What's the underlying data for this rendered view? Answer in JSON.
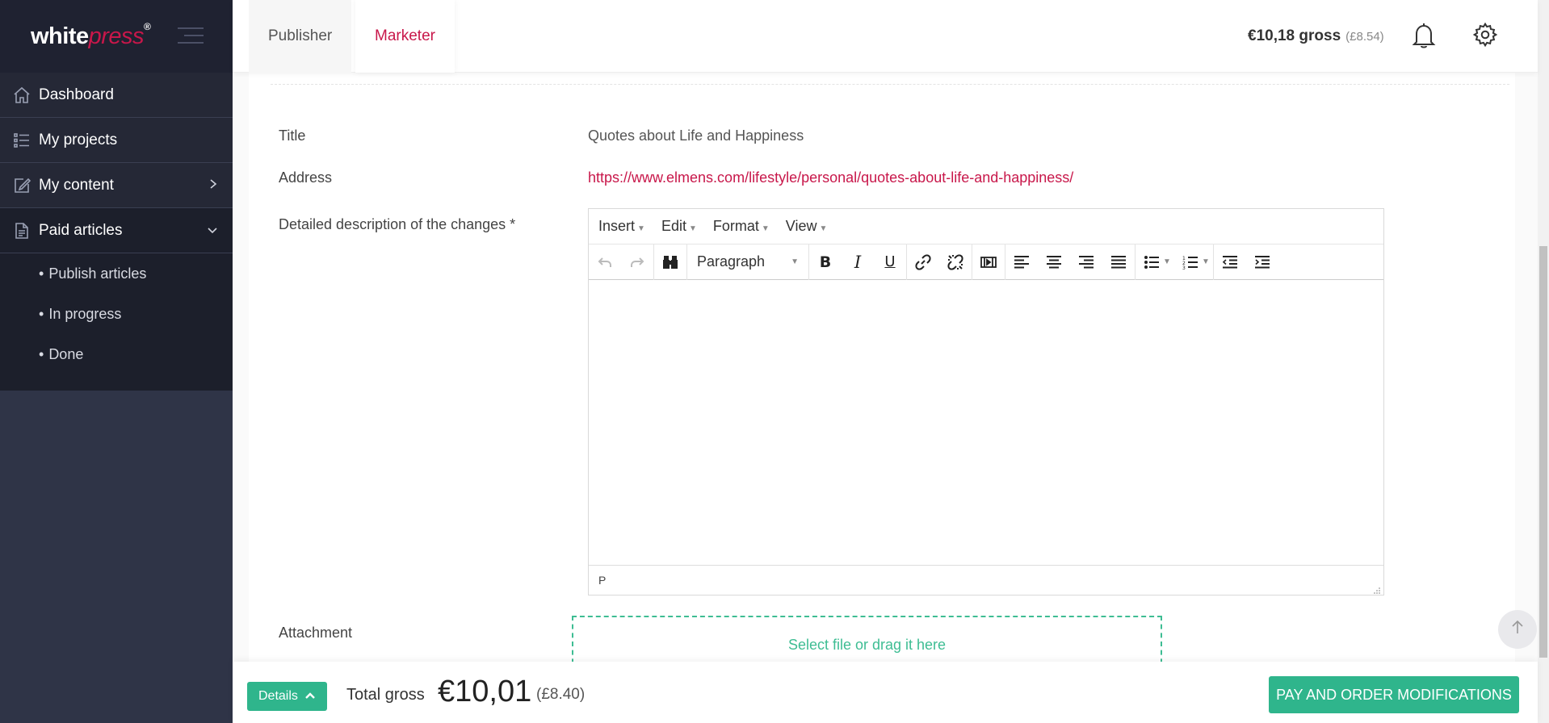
{
  "app": {
    "logo_main": "white",
    "logo_accent": "press",
    "logo_reg": "®"
  },
  "sidebar": {
    "items": [
      {
        "label": "Dashboard",
        "icon": "home-icon"
      },
      {
        "label": "My projects",
        "icon": "list-icon"
      },
      {
        "label": "My content",
        "icon": "edit-icon"
      },
      {
        "label": "Paid articles",
        "icon": "document-icon"
      }
    ],
    "subitems": [
      {
        "bullet": "•",
        "label": "Publish articles"
      },
      {
        "bullet": "•",
        "label": "In progress"
      },
      {
        "bullet": "•",
        "label": "Done"
      }
    ]
  },
  "header": {
    "tabs": [
      {
        "label": "Publisher"
      },
      {
        "label": "Marketer"
      }
    ],
    "balance": "€10,18 gross",
    "balance_gbp": "(£8.54)"
  },
  "form": {
    "title_label": "Title",
    "title_value": "Quotes about Life and Happiness",
    "address_label": "Address",
    "address_value": "https://www.elmens.com/lifestyle/personal/quotes-about-life-and-happiness/",
    "description_label": "Detailed description of the changes *",
    "attachment_label": "Attachment",
    "dropzone_text": "Select file or drag it here"
  },
  "editor": {
    "menus": [
      "Insert",
      "Edit",
      "Format",
      "View"
    ],
    "block_format": "Paragraph",
    "status_path": "P"
  },
  "footer": {
    "details_label": "Details",
    "total_label": "Total gross",
    "total_value": "€10,01",
    "total_gbp": "(£8.40)",
    "pay_label": "PAY AND ORDER MODIFICATIONS"
  },
  "colors": {
    "accent": "#c8174a",
    "green": "#2fb58c",
    "sidebar": "#2f3447"
  }
}
